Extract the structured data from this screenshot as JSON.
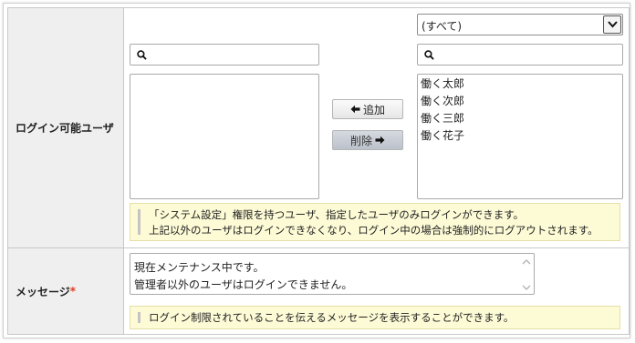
{
  "login_users": {
    "label": "ログイン可能ユーザ",
    "filter_select_value": "(すべて)",
    "left_search_value": "",
    "right_search_value": "",
    "available_users": [],
    "selected_users": [
      "働く太郎",
      "働く次郎",
      "働く三郎",
      "働く花子"
    ],
    "add_button_label": "追加",
    "remove_button_label": "削除",
    "note_line1": "「システム設定」権限を持つユーザ、指定したユーザのみログインができます。",
    "note_line2": "上記以外のユーザはログインできなくなり、ログイン中の場合は強制的にログアウトされます。"
  },
  "message": {
    "label": "メッセージ",
    "required_mark": "*",
    "textarea_line1": "現在メンテナンス中です。",
    "textarea_line2": "管理者以外のユーザはログインできません。",
    "note": "ログイン制限されていることを伝えるメッセージを表示することができます。"
  },
  "colors": {
    "required": "#e23b1e",
    "note_bg": "#fdfbd6",
    "label_bg": "#efefef"
  }
}
